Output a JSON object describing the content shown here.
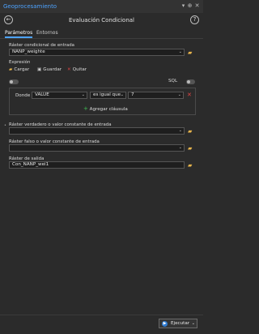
{
  "app": {
    "title": "Geoprocesamiento"
  },
  "header": {
    "tool_title": "Evaluación Condicional"
  },
  "tabs": [
    {
      "label": "Parámetros",
      "active": true
    },
    {
      "label": "Entornos",
      "active": false
    }
  ],
  "fields": {
    "input_raster_label": "Ráster condicional de entrada",
    "input_raster_value": "NANP_weighte",
    "expression_label": "Expresión",
    "actions": {
      "load": "Cargar",
      "save": "Guardar",
      "remove": "Quitar"
    },
    "sql_label": "SQL",
    "clause": {
      "prefix": "Donde",
      "field": "VALUE",
      "operator": "es igual que",
      "value": "7",
      "add_clause": "Agregar cláusula"
    },
    "true_raster_label": "Ráster verdadero o valor constante de entrada",
    "true_raster_value": "",
    "false_raster_label": "Ráster falso o valor constante de entrada",
    "false_raster_value": "",
    "output_raster_label": "Ráster de salida",
    "output_raster_value": "Con_NANP_wei1"
  },
  "footer": {
    "run_label": "Ejecutar"
  },
  "colors": {
    "accent": "#4da3ff",
    "folder": "#e8b64c",
    "remove": "#e04343"
  }
}
